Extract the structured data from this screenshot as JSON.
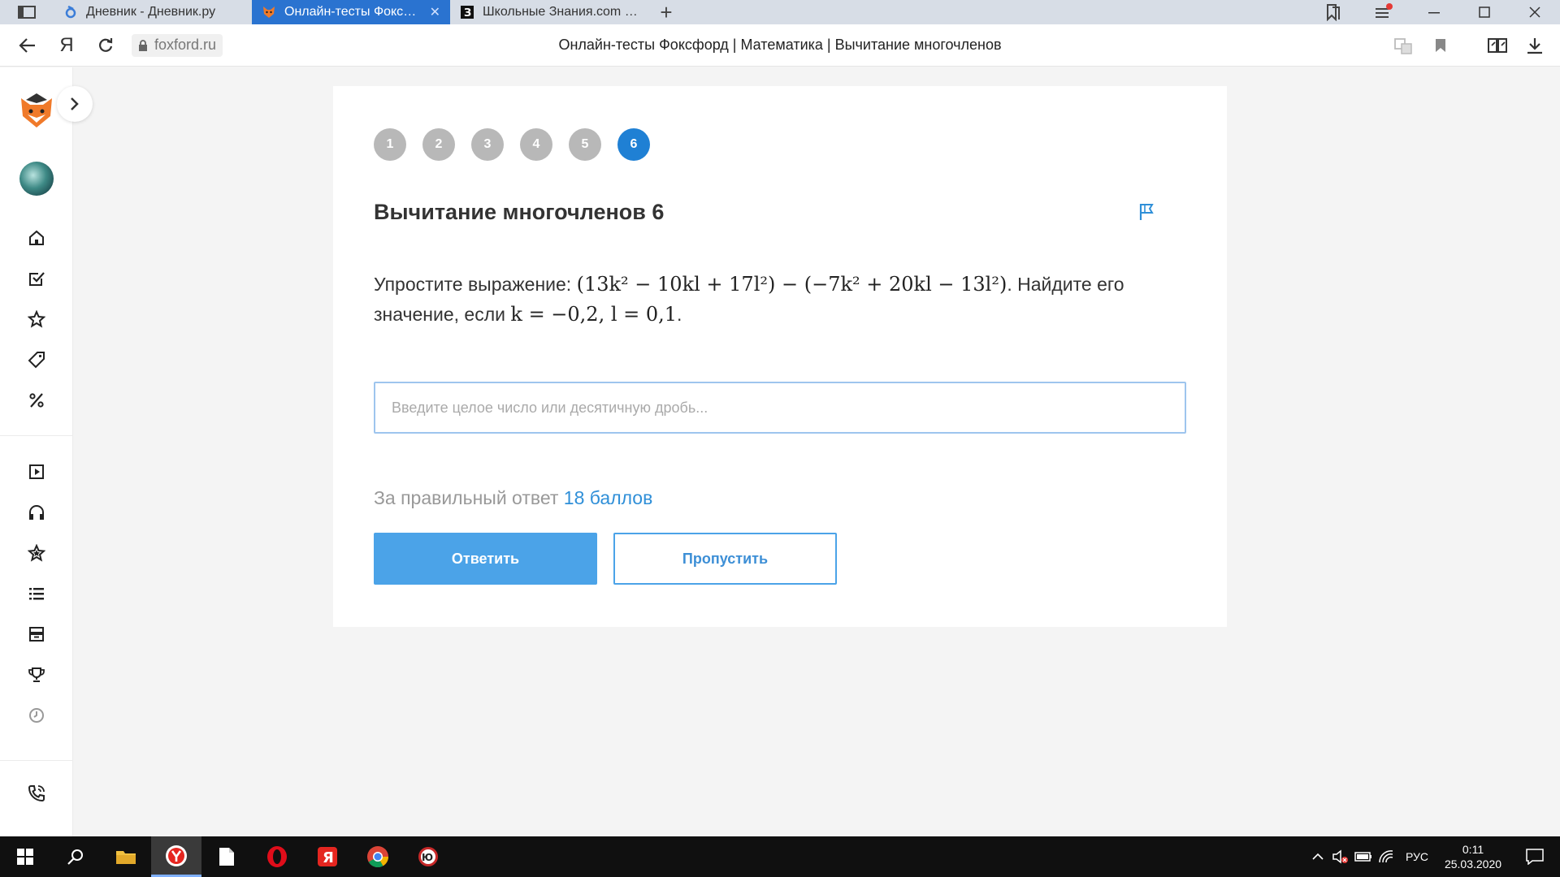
{
  "browser": {
    "tabs": [
      {
        "title": "Дневник - Дневник.ру",
        "active": false
      },
      {
        "title": "Онлайн-тесты Фоксфорд",
        "active": true
      },
      {
        "title": "Школьные Знания.com - Р",
        "active": false
      }
    ],
    "url": "foxford.ru",
    "page_title": "Онлайн-тесты Фоксфорд | Математика | Вычитание многочленов",
    "yandex_letter": "Я"
  },
  "sidebar": {
    "top_icons": [
      "home-icon",
      "checkbox-icon",
      "star-icon",
      "tag-icon",
      "percent-icon"
    ],
    "bottom_icons": [
      "play-icon",
      "headphones-icon",
      "star-outline-icon",
      "list-icon",
      "archive-icon",
      "trophy-icon",
      "clock-icon"
    ],
    "phone_icon": "phone-icon"
  },
  "quiz": {
    "steps": [
      "1",
      "2",
      "3",
      "4",
      "5",
      "6"
    ],
    "current_step": "6",
    "title": "Вычитание многочленов 6",
    "question_prefix": "Упростите выражение: ",
    "question_expression": "(13k² − 10kl + 17l²) − (−7k² + 20kl − 13l²)",
    "question_middle": ". Найдите его значение, если ",
    "question_values": "k = −0,2, l = 0,1",
    "question_suffix": ".",
    "answer_placeholder": "Введите целое число или десятичную дробь...",
    "answer_value": "",
    "points_prefix": "За правильный ответ",
    "points_value": "18 баллов",
    "answer_button": "Ответить",
    "skip_button": "Пропустить"
  },
  "taskbar": {
    "language": "РУС",
    "time": "0:11",
    "date": "25.03.2020"
  },
  "colors": {
    "accent": "#1f80d4",
    "button": "#4ba3e8",
    "points": "#2f8fd8",
    "tab_active": "#2a73d0"
  }
}
